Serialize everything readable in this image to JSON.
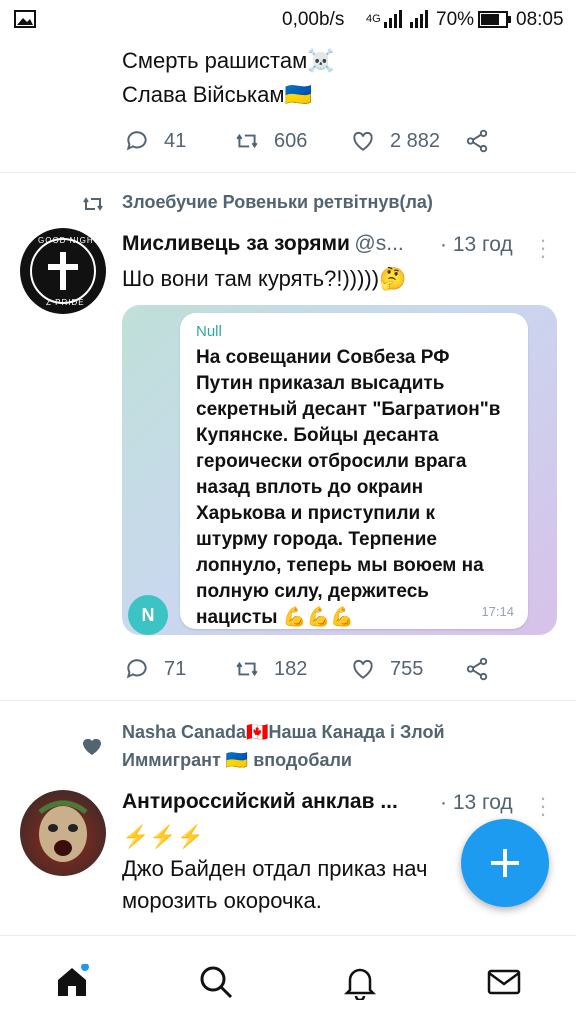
{
  "status_bar": {
    "speed": "0,00b/s",
    "network": "4G",
    "battery": "70%",
    "time": "08:05"
  },
  "tweet_prev": {
    "lines": [
      "Смерть рашистам☠️",
      "Слава Військам🇺🇦"
    ],
    "actions": {
      "replies": "41",
      "retweets": "606",
      "likes": "2 882"
    }
  },
  "tweet_main": {
    "retweeted_by": "Злоебучие Ровеньки ретвітнув(ла)",
    "author_name": "Мисливець за зорями",
    "author_handle": "@s...",
    "time": "· 13 год",
    "text": "Шо вони там курять?!)))))🤔",
    "avatar_text_top": "GOOD NIGHT",
    "avatar_text_bottom": "Z PRIDE",
    "media": {
      "sender": "Null",
      "message": "На совещании Совбеза РФ\nПутин приказал высадить\nсекретный десант \"Багратион\"в\nКупянске. Бойцы десанта\nгероически отбросили врага\nназад вплоть до окраин\nХарькова и приступили к\nштурму города. Терпение\nлопнуло, теперь мы воюем на\nполную силу, держитесь\nнацисты 💪💪💪",
      "message_time": "17:14",
      "badge_letter": "N"
    },
    "actions": {
      "replies": "71",
      "retweets": "182",
      "likes": "755"
    }
  },
  "tweet_next": {
    "liked_by_line1": "Nasha Canada🇨🇦Наша Канада і Злой",
    "liked_by_line2": "Иммигрант 🇺🇦 вподобали",
    "author_name": "Антироссийский анклав ...",
    "time": "· 13 год",
    "text_line1": "⚡⚡⚡",
    "text_line2": "Джо Байден отдал приказ нач",
    "text_line3": "морозить окорочка."
  },
  "colors": {
    "accent": "#1d9bf0",
    "muted": "#536471",
    "divider": "#e6ecf0"
  }
}
